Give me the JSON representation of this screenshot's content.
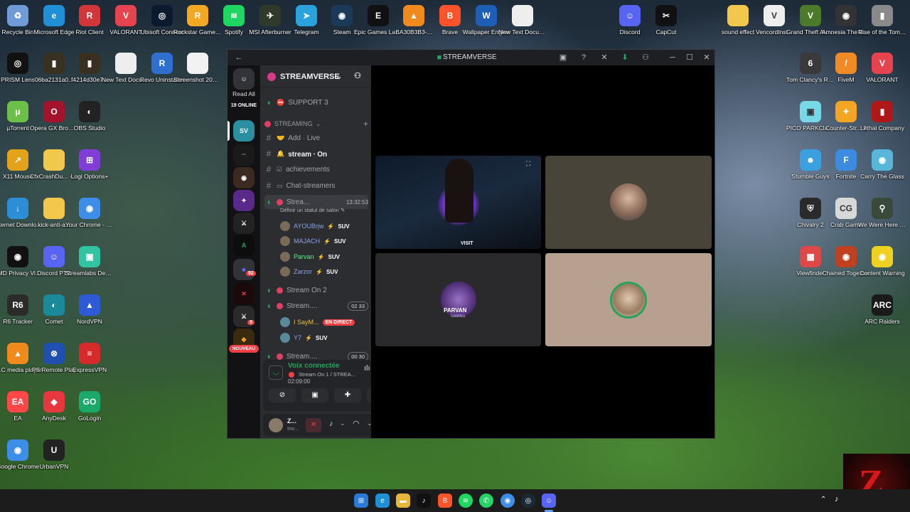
{
  "desktop_icons_left": [
    {
      "label": "Recycle Bin",
      "icon": "recycle-bin-icon",
      "color": "#6f9bd8",
      "glyph": "♻"
    },
    {
      "label": "Microsoft Edge",
      "icon": "edge-icon",
      "color": "#1f8fd6",
      "glyph": "e"
    },
    {
      "label": "Riot Client",
      "icon": "riot-icon",
      "color": "#d13639",
      "glyph": "R"
    },
    {
      "label": "VALORANT",
      "icon": "valorant-icon",
      "color": "#e5434d",
      "glyph": "V"
    },
    {
      "label": "Ubisoft Connect",
      "icon": "ubisoft-icon",
      "color": "#0b1a2f",
      "glyph": "◎"
    },
    {
      "label": "Rockstar Games ...",
      "icon": "rockstar-icon",
      "color": "#f3a823",
      "glyph": "R"
    },
    {
      "label": "Spotify",
      "icon": "spotify-icon",
      "color": "#1ed760",
      "glyph": "≋"
    },
    {
      "label": "MSI Afterburner",
      "icon": "msi-icon",
      "color": "#2f3a2a",
      "glyph": "✈"
    },
    {
      "label": "Telegram",
      "icon": "telegram-icon",
      "color": "#2aa3dd",
      "glyph": "➤"
    },
    {
      "label": "Steam",
      "icon": "steam-icon",
      "color": "#1b3a5a",
      "glyph": "◉"
    },
    {
      "label": "Epic Games Launcher",
      "icon": "epic-icon",
      "color": "#111111",
      "glyph": "E"
    },
    {
      "label": "BA30B3B3-...",
      "icon": "vlc-icon",
      "color": "#f08a1c",
      "glyph": "▲"
    },
    {
      "label": "Brave",
      "icon": "brave-icon",
      "color": "#fb542b",
      "glyph": "B"
    },
    {
      "label": "Wallpaper Engine",
      "icon": "wallpaper-icon",
      "color": "#1d5fb6",
      "glyph": "W"
    },
    {
      "label": "New Text Docume...",
      "icon": "text-doc-icon",
      "color": "#eeeeee",
      "glyph": ""
    }
  ],
  "desktop_grid_left": [
    {
      "label": "PRISM Lens",
      "icon": "prism-icon",
      "color": "#111111",
      "glyph": "◎"
    },
    {
      "label": "06ba2131a0...",
      "icon": "file-icon",
      "color": "#3a3020",
      "glyph": "▮"
    },
    {
      "label": "f4214d30e7...",
      "icon": "file-icon",
      "color": "#3a3020",
      "glyph": "▮"
    },
    {
      "label": "New Text Document",
      "icon": "text-doc-icon",
      "color": "#eeeeee",
      "glyph": ""
    },
    {
      "label": "Revo Uninstaller",
      "icon": "revo-icon",
      "color": "#2f6fd0",
      "glyph": "R"
    },
    {
      "label": "Screenshot 2026-01-...",
      "icon": "image-icon",
      "color": "#f2f2f2",
      "glyph": ""
    },
    {
      "label": "µTorrent",
      "icon": "utorrent-icon",
      "color": "#6cc04a",
      "glyph": "µ"
    },
    {
      "label": "Opera GX Browser",
      "icon": "opera-icon",
      "color": "#a4122b",
      "glyph": "O"
    },
    {
      "label": "OBS Studio",
      "icon": "obs-icon",
      "color": "#222222",
      "glyph": "◐"
    },
    {
      "label": "X11 Mouse",
      "icon": "mouse-icon",
      "color": "#e2a21a",
      "glyph": "↗"
    },
    {
      "label": "CfxCrashDu... - Shortcut",
      "icon": "folder-icon",
      "color": "#f1c84b",
      "glyph": ""
    },
    {
      "label": "Logi Options+",
      "icon": "logi-icon",
      "color": "#7f3fd6",
      "glyph": "⊞"
    },
    {
      "label": "Internet Downlo...",
      "icon": "idm-icon",
      "color": "#2b8ed6",
      "glyph": "↓"
    },
    {
      "label": "kick-anti-a...",
      "icon": "folder-icon",
      "color": "#f1c84b",
      "glyph": ""
    },
    {
      "label": "Your Chrome - Chrome",
      "icon": "chrome-icon",
      "color": "#3c8ee8",
      "glyph": "◉"
    },
    {
      "label": "AMD Privacy View",
      "icon": "amd-icon",
      "color": "#111111",
      "glyph": "◉"
    },
    {
      "label": "Discord PTB",
      "icon": "discord-icon",
      "color": "#5865f2",
      "glyph": "☺"
    },
    {
      "label": "Streamlabs Desktop",
      "icon": "streamlabs-icon",
      "color": "#31c3a2",
      "glyph": "▣"
    },
    {
      "label": "R6 Tracker",
      "icon": "r6-icon",
      "color": "#2b2b2b",
      "glyph": "R6"
    },
    {
      "label": "Comet",
      "icon": "comet-icon",
      "color": "#1a8a9a",
      "glyph": "◐"
    },
    {
      "label": "NordVPN",
      "icon": "nordvpn-icon",
      "color": "#2d5bd8",
      "glyph": "▲"
    },
    {
      "label": "VLC media player",
      "icon": "vlc-icon",
      "color": "#f08a1c",
      "glyph": "▲"
    },
    {
      "label": "PS Remote Play",
      "icon": "ps-icon",
      "color": "#1f4fb0",
      "glyph": "⊗"
    },
    {
      "label": "ExpressVPN",
      "icon": "express-icon",
      "color": "#d72a2a",
      "glyph": "≡"
    },
    {
      "label": "EA",
      "icon": "ea-icon",
      "color": "#ff4747",
      "glyph": "EA"
    },
    {
      "label": "AnyDesk",
      "icon": "anydesk-icon",
      "color": "#e8383d",
      "glyph": "◆"
    },
    {
      "label": "GoLogin",
      "icon": "gologin-icon",
      "color": "#1ba86b",
      "glyph": "GO"
    },
    {
      "label": "Google Chrome",
      "icon": "chrome-icon",
      "color": "#3c8ee8",
      "glyph": "◉"
    },
    {
      "label": "UrbanVPN",
      "icon": "urban-icon",
      "color": "#222222",
      "glyph": "U"
    }
  ],
  "desktop_icons_right": [
    {
      "label": "Discord",
      "icon": "discord-icon",
      "color": "#5865f2",
      "glyph": "☺"
    },
    {
      "label": "CapCut",
      "icon": "capcut-icon",
      "color": "#111111",
      "glyph": "✂"
    },
    {
      "label": "sound effect",
      "icon": "folder-icon",
      "color": "#f1c84b",
      "glyph": ""
    },
    {
      "label": "VencordInst...",
      "icon": "vencord-icon",
      "color": "#eeeeee",
      "glyph": "V"
    },
    {
      "label": "Grand Theft Auto V Le...",
      "icon": "gta-icon",
      "color": "#4a7a2a",
      "glyph": "V"
    },
    {
      "label": "Amnesia The Bunker",
      "icon": "amnesia-icon",
      "color": "#333333",
      "glyph": "◉"
    },
    {
      "label": "Rise of the Tomb Raid...",
      "icon": "tombraider-icon",
      "color": "#8a8a8a",
      "glyph": "▮"
    },
    {
      "label": "Tom Clancy's Rainbow Si...",
      "icon": "r6siege-icon",
      "color": "#3a3a3a",
      "glyph": "6"
    },
    {
      "label": "FiveM",
      "icon": "fivem-icon",
      "color": "#f08a24",
      "glyph": "/"
    },
    {
      "label": "VALORANT",
      "icon": "valorant-icon",
      "color": "#e5434d",
      "glyph": "V"
    },
    {
      "label": "PICO PARKClass...",
      "icon": "pico-icon",
      "color": "#77d8e8",
      "glyph": "▣"
    },
    {
      "label": "Counter-Str... 2",
      "icon": "cs2-icon",
      "color": "#f3a523",
      "glyph": "✦"
    },
    {
      "label": "Lethal Company",
      "icon": "lethal-icon",
      "color": "#b01818",
      "glyph": "▮"
    },
    {
      "label": "Stumble Guys",
      "icon": "stumble-icon",
      "color": "#3aa0e0",
      "glyph": "☻"
    },
    {
      "label": "Fortnite",
      "icon": "fortnite-icon",
      "color": "#3b8be0",
      "glyph": "F"
    },
    {
      "label": "Carry The Glass",
      "icon": "glass-icon",
      "color": "#58b6d8",
      "glyph": "◉"
    },
    {
      "label": "Chivalry 2",
      "icon": "chivalry-icon",
      "color": "#2a2a2a",
      "glyph": "⛨"
    },
    {
      "label": "Crab Game",
      "icon": "crab-icon",
      "color": "#d8d8d8",
      "glyph": "CG"
    },
    {
      "label": "We Were Here Exp...",
      "icon": "wewerehere-icon",
      "color": "#3a4a3a",
      "glyph": "⚲"
    },
    {
      "label": "Viewfinder",
      "icon": "viewfinder-icon",
      "color": "#e04848",
      "glyph": "▦"
    },
    {
      "label": "Chained Together",
      "icon": "chained-icon",
      "color": "#c04020",
      "glyph": "◉"
    },
    {
      "label": "Content Warning",
      "icon": "contentwarning-icon",
      "color": "#f0d020",
      "glyph": "◉"
    },
    {
      "label": "ARC Raiders",
      "icon": "arc-icon",
      "color": "#1a1a1a",
      "glyph": "ARC"
    }
  ],
  "window": {
    "title": "STREAMVERSE",
    "back": "←",
    "controls": [
      "─",
      "☐",
      "✕"
    ]
  },
  "rail": {
    "read_all": "Read All",
    "online": "19 ONLINE",
    "badge_92": "92",
    "badge_9": "9",
    "nouveau": "NOUVEAU"
  },
  "server": {
    "name": "STREAMVERSE",
    "channels": [
      {
        "kind": "voice",
        "label": "SUPPORT 3",
        "emoji": "⛔"
      },
      {
        "kind": "category",
        "label": "STREAMING"
      },
      {
        "kind": "text",
        "label": "Add · Live",
        "emoji": "🤝"
      },
      {
        "kind": "text",
        "label": "stream ⸱ On",
        "emoji": "🔔"
      },
      {
        "kind": "text",
        "label": "achievements",
        "emoji": "☑"
      },
      {
        "kind": "text",
        "label": "Chat-streamers",
        "emoji": "▭"
      },
      {
        "kind": "voice",
        "label": "Strea...",
        "time": "13:32:53",
        "status": "Définir un statut de salon"
      },
      {
        "kind": "voice",
        "label": "Stream On 2"
      },
      {
        "kind": "voice",
        "label": "Stream....",
        "count": "02",
        "limit": "33"
      },
      {
        "kind": "voice",
        "label": "Stream....",
        "count": "00",
        "limit": "30"
      }
    ],
    "users_a": [
      {
        "name": "AYOUBrjw",
        "color": "#8ea1e1",
        "tag": "SUV"
      },
      {
        "name": "MAJACH",
        "color": "#8ea1e1",
        "tag": "SUV"
      },
      {
        "name": "Parvan",
        "color": "#57f287",
        "tag": "SUV"
      },
      {
        "name": "Zarzor",
        "color": "#8ea1e1",
        "tag": "SUV"
      }
    ],
    "users_b": [
      {
        "name": "I SayM...",
        "color": "#f0c040",
        "tag": "EN DIRECT"
      },
      {
        "name": "Y7",
        "color": "#8ea1e1",
        "tag": "SUV"
      }
    ]
  },
  "voice_panel": {
    "status": "Voix connectée",
    "channel": "Stream On 1 / STREA...",
    "timer": "02:09:00"
  },
  "user_panel": {
    "name": "Z...",
    "sub": "Inv..."
  },
  "video": {
    "tile1_caption": "VISIT",
    "tile3_name": "PARVAN",
    "tile3_sub": "GAMING"
  },
  "taskbar": {
    "icons": [
      "windows-start-icon",
      "edge-icon",
      "file-explorer-icon",
      "tiktok-icon",
      "brave-icon",
      "spotify-icon",
      "whatsapp-icon",
      "chrome-icon",
      "steam-icon",
      "discord-icon"
    ]
  }
}
